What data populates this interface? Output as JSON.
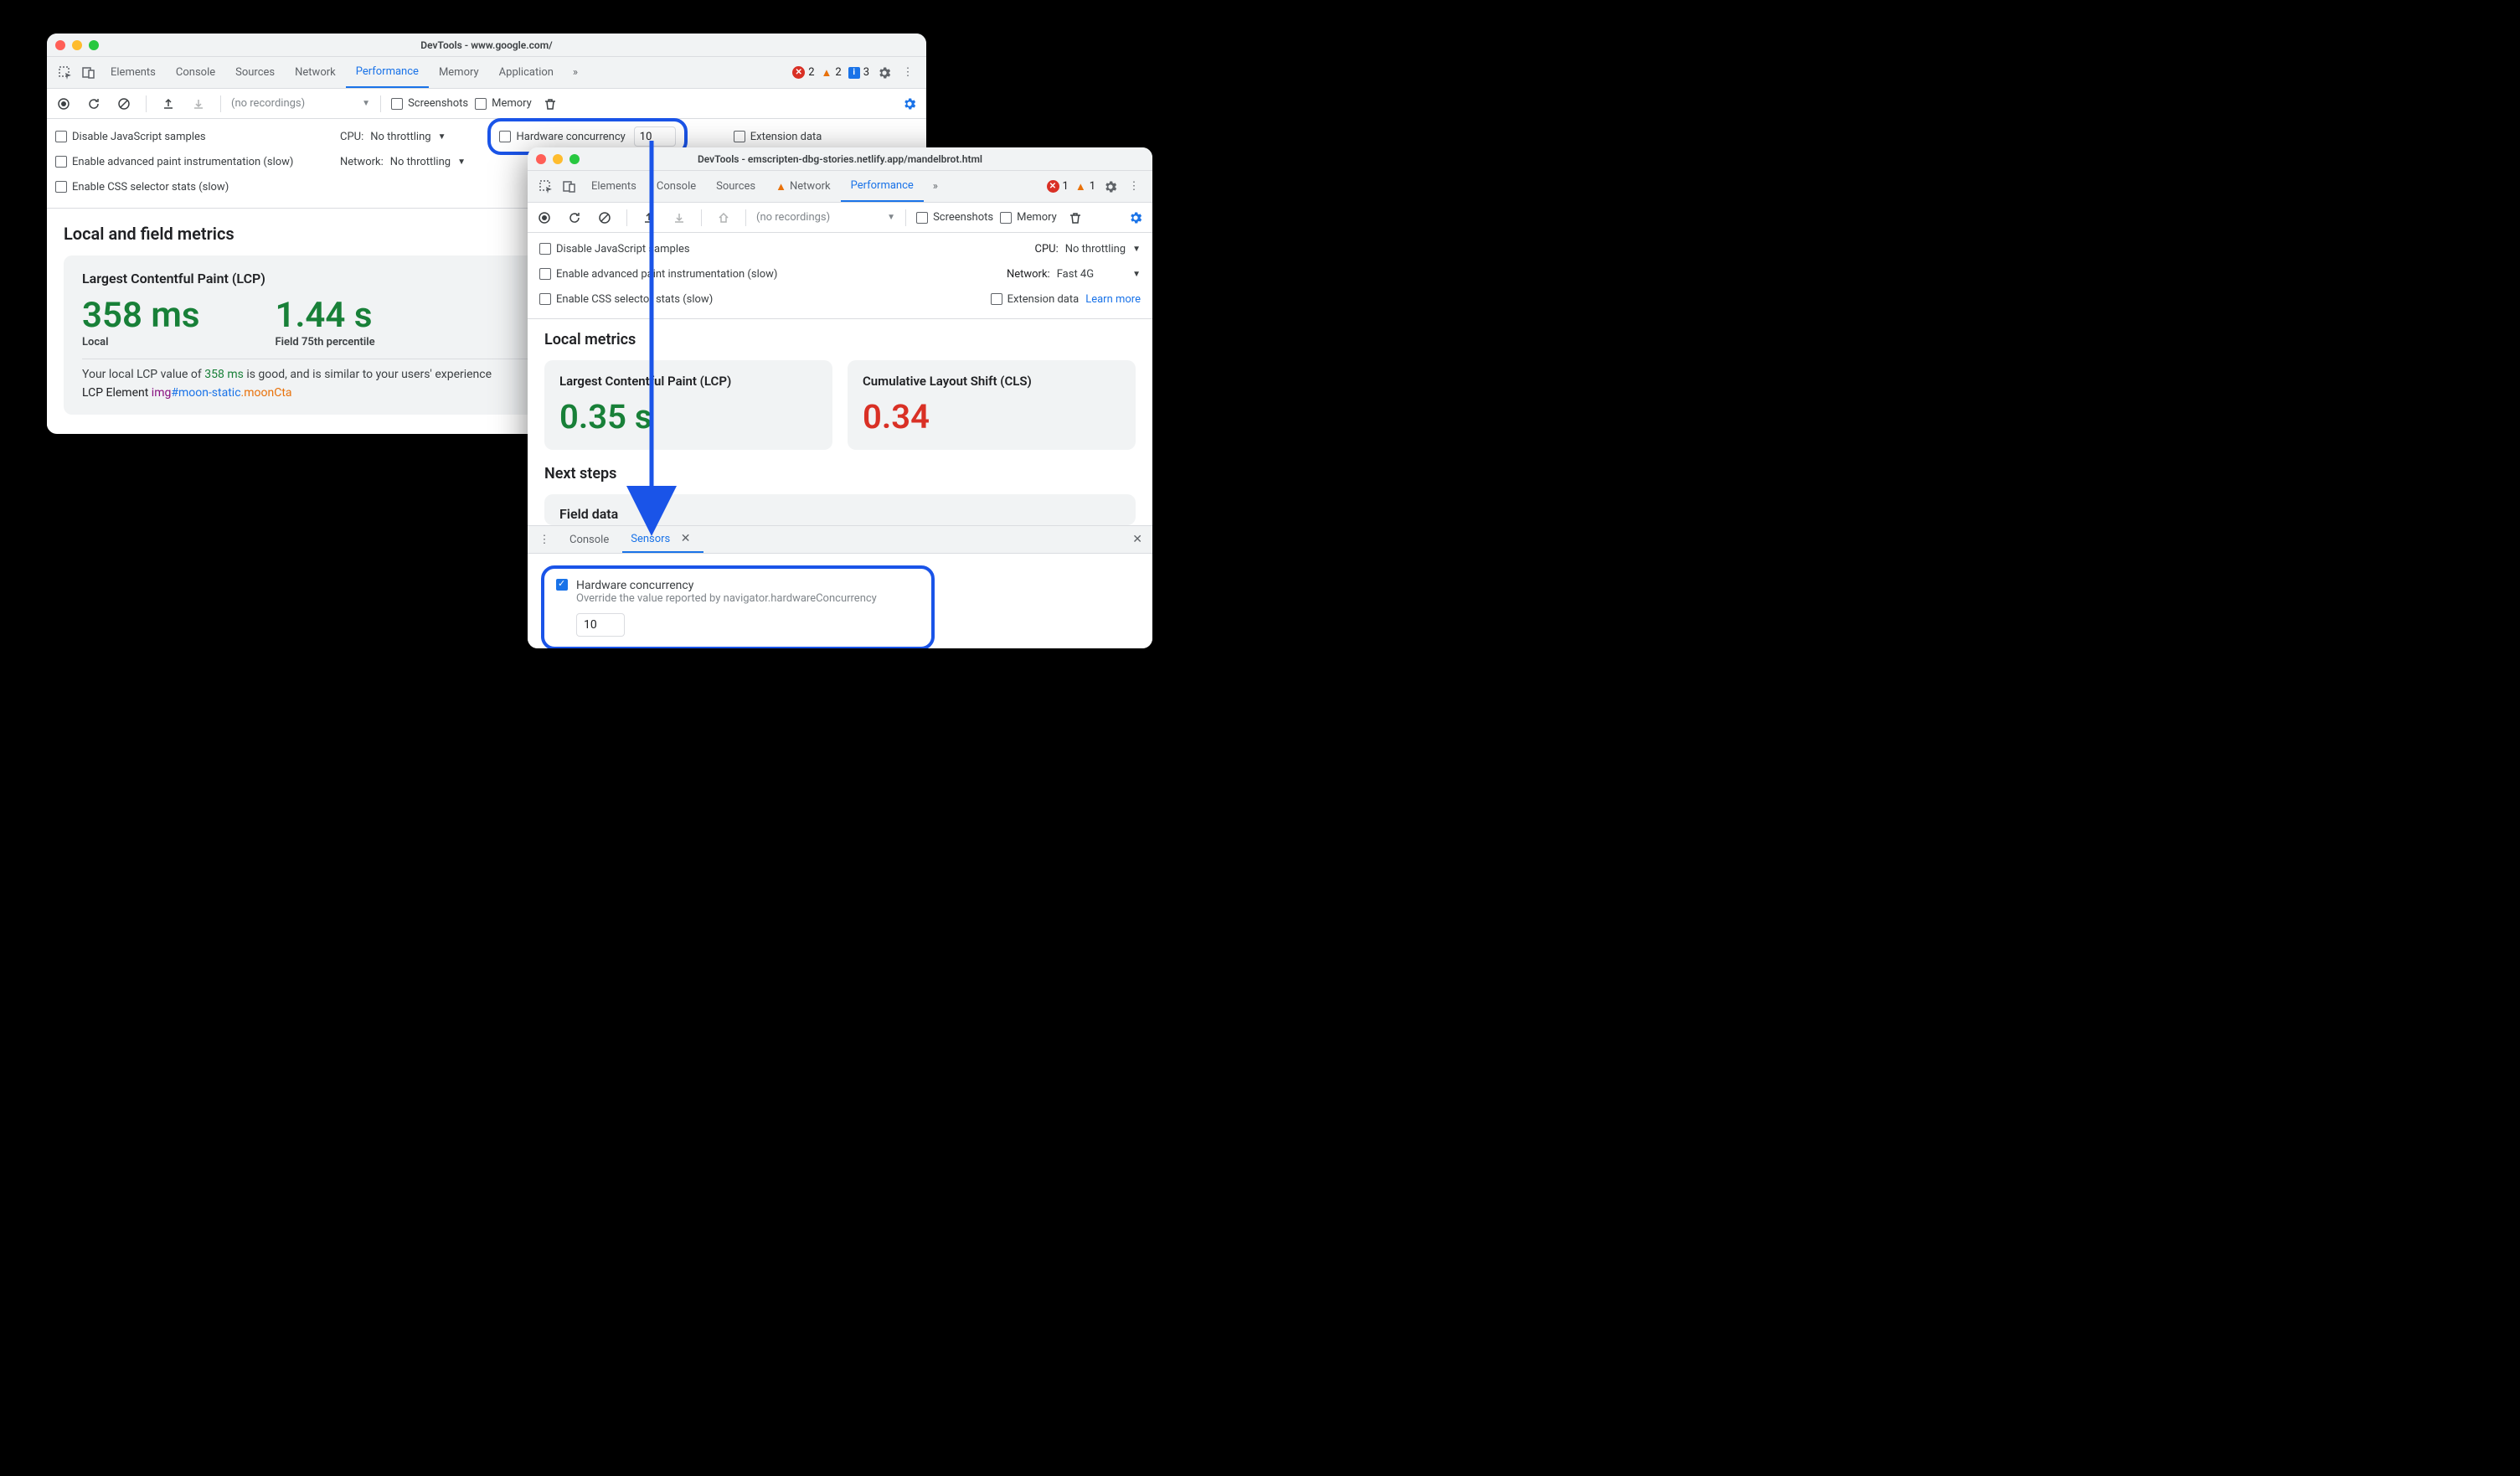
{
  "window1": {
    "title": "DevTools - www.google.com/",
    "tabs": [
      "Elements",
      "Console",
      "Sources",
      "Network",
      "Performance",
      "Memory",
      "Application"
    ],
    "active_tab": "Performance",
    "badges": {
      "errors": "2",
      "warnings": "2",
      "info": "3"
    },
    "toolbar": {
      "recordings_placeholder": "(no recordings)",
      "screenshots": "Screenshots",
      "memory": "Memory"
    },
    "options": {
      "disable_js": "Disable JavaScript samples",
      "paint_instr": "Enable advanced paint instrumentation (slow)",
      "css_stats": "Enable CSS selector stats (slow)",
      "cpu_label": "CPU:",
      "cpu_value": "No throttling",
      "net_label": "Network:",
      "net_value": "No throttling",
      "hw_concurrency_label": "Hardware concurrency",
      "hw_concurrency_value": "10",
      "extension_data": "Extension data"
    },
    "metrics": {
      "section_title": "Local and field metrics",
      "lcp_title": "Largest Contentful Paint (LCP)",
      "local_value": "358 ms",
      "local_label": "Local",
      "field_value": "1.44 s",
      "field_label": "Field 75th percentile",
      "desc_pre": "Your local LCP value of ",
      "desc_val": "358 ms",
      "desc_post": " is good, and is similar to your users' experience",
      "lcp_el_label": "LCP Element ",
      "lcp_el_tag": "img",
      "lcp_el_id": "#moon-static",
      "lcp_el_class": ".moonCta"
    }
  },
  "window2": {
    "title": "DevTools - emscripten-dbg-stories.netlify.app/mandelbrot.html",
    "tabs": [
      "Elements",
      "Console",
      "Sources",
      "Network",
      "Performance"
    ],
    "active_tab": "Performance",
    "network_warn": true,
    "badges": {
      "errors": "1",
      "warnings": "1"
    },
    "toolbar": {
      "recordings_placeholder": "(no recordings)",
      "screenshots": "Screenshots",
      "memory": "Memory"
    },
    "options": {
      "disable_js": "Disable JavaScript samples",
      "paint_instr": "Enable advanced paint instrumentation (slow)",
      "css_stats": "Enable CSS selector stats (slow)",
      "cpu_label": "CPU:",
      "cpu_value": "No throttling",
      "net_label": "Network:",
      "net_value": "Fast 4G",
      "extension_data": "Extension data",
      "learn_more": "Learn more"
    },
    "metrics": {
      "section_title": "Local metrics",
      "lcp_title": "Largest Contentful Paint (LCP)",
      "lcp_value": "0.35 s",
      "cls_title": "Cumulative Layout Shift (CLS)",
      "cls_value": "0.34",
      "next_steps": "Next steps",
      "field_data": "Field data"
    },
    "drawer": {
      "tabs": [
        "Console",
        "Sensors"
      ],
      "active": "Sensors",
      "hw_label": "Hardware concurrency",
      "hw_desc": "Override the value reported by navigator.hardwareConcurrency",
      "hw_value": "10"
    }
  }
}
